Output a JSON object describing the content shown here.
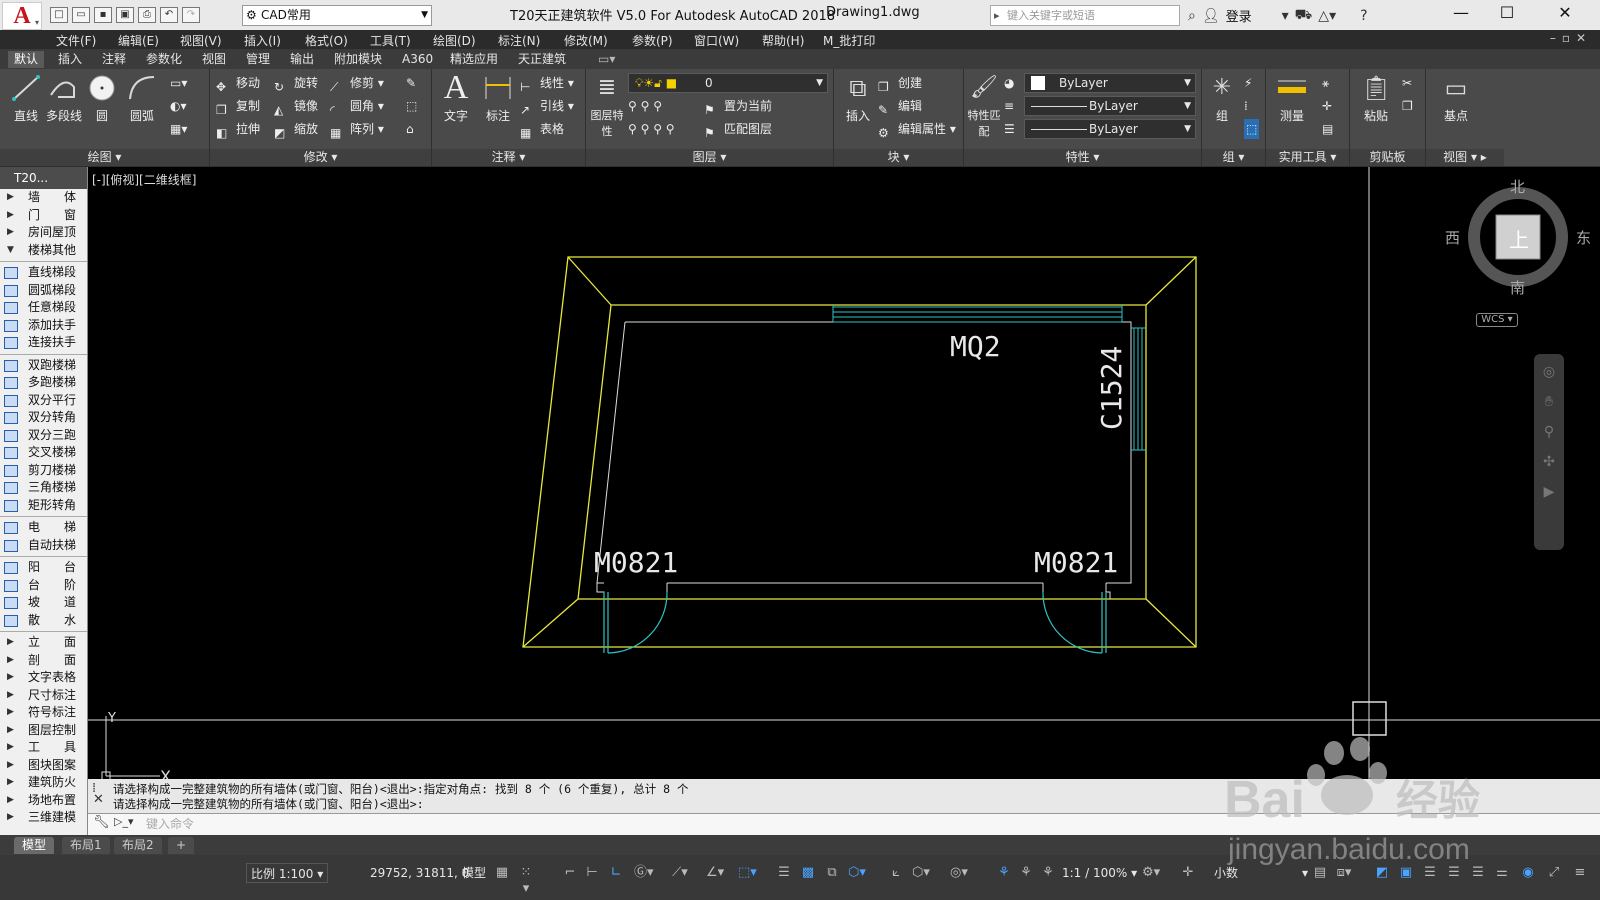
{
  "titlebar": {
    "app_version_badge": "T20",
    "workspace": "CAD常用",
    "title": "T20天正建筑软件 V5.0 For Autodesk AutoCAD 2018",
    "file": "Drawing1.dwg",
    "search_placeholder": "键入关键字或短语",
    "login": "登录"
  },
  "menu": [
    "文件(F)",
    "编辑(E)",
    "视图(V)",
    "插入(I)",
    "格式(O)",
    "工具(T)",
    "绘图(D)",
    "标注(N)",
    "修改(M)",
    "参数(P)",
    "窗口(W)",
    "帮助(H)",
    "M_批打印"
  ],
  "ribbon_tabs": [
    "默认",
    "插入",
    "注释",
    "参数化",
    "视图",
    "管理",
    "输出",
    "附加模块",
    "A360",
    "精选应用",
    "天正建筑"
  ],
  "ribbon": {
    "draw": {
      "title": "绘图",
      "line": "直线",
      "polyline": "多段线",
      "circle": "圆",
      "arc": "圆弧"
    },
    "modify": {
      "title": "修改",
      "move": "移动",
      "rotate": "旋转",
      "trim": "修剪",
      "copy": "复制",
      "mirror": "镜像",
      "fillet": "圆角",
      "stretch": "拉伸",
      "scale": "缩放",
      "array": "阵列"
    },
    "annotation": {
      "title": "注释",
      "text": "文字",
      "dimension": "标注",
      "linear": "线性",
      "leader": "引线",
      "table": "表格"
    },
    "layers": {
      "title": "图层",
      "props": "图层特性",
      "current_layer": "0",
      "set_current": "置为当前",
      "match_layer": "匹配图层"
    },
    "block": {
      "title": "块",
      "insert": "插入",
      "create": "创建",
      "edit": "编辑",
      "edit_attr": "编辑属性"
    },
    "properties": {
      "title": "特性",
      "match": "特性匹配",
      "color": "ByLayer",
      "linetype": "ByLayer",
      "lineweight": "ByLayer"
    },
    "groups": {
      "title": "组",
      "group": "组"
    },
    "utilities": {
      "title": "实用工具",
      "measure": "测量"
    },
    "clipboard": {
      "title": "剪贴板",
      "paste": "粘贴"
    },
    "view": {
      "title": "视图",
      "base": "基点"
    }
  },
  "palette": {
    "header": "T20...",
    "items": [
      {
        "label": "墙　　体",
        "type": "folder"
      },
      {
        "label": "门　　窗",
        "type": "folder"
      },
      {
        "label": "房间屋顶",
        "type": "folder"
      },
      {
        "label": "楼梯其他",
        "type": "open"
      },
      {
        "label": "直线梯段",
        "type": "tool"
      },
      {
        "label": "圆弧梯段",
        "type": "tool"
      },
      {
        "label": "任意梯段",
        "type": "tool"
      },
      {
        "label": "添加扶手",
        "type": "tool"
      },
      {
        "label": "连接扶手",
        "type": "tool"
      },
      {
        "label": "双跑楼梯",
        "type": "tool"
      },
      {
        "label": "多跑楼梯",
        "type": "tool"
      },
      {
        "label": "双分平行",
        "type": "tool"
      },
      {
        "label": "双分转角",
        "type": "tool"
      },
      {
        "label": "双分三跑",
        "type": "tool"
      },
      {
        "label": "交叉楼梯",
        "type": "tool"
      },
      {
        "label": "剪刀楼梯",
        "type": "tool"
      },
      {
        "label": "三角楼梯",
        "type": "tool"
      },
      {
        "label": "矩形转角",
        "type": "tool"
      },
      {
        "label": "电　　梯",
        "type": "tool"
      },
      {
        "label": "自动扶梯",
        "type": "tool"
      },
      {
        "label": "阳　　台",
        "type": "tool"
      },
      {
        "label": "台　　阶",
        "type": "tool"
      },
      {
        "label": "坡　　道",
        "type": "tool"
      },
      {
        "label": "散　　水",
        "type": "tool"
      },
      {
        "label": "立　　面",
        "type": "folder"
      },
      {
        "label": "剖　　面",
        "type": "folder"
      },
      {
        "label": "文字表格",
        "type": "folder"
      },
      {
        "label": "尺寸标注",
        "type": "folder"
      },
      {
        "label": "符号标注",
        "type": "folder"
      },
      {
        "label": "图层控制",
        "type": "folder"
      },
      {
        "label": "工　　具",
        "type": "folder"
      },
      {
        "label": "图块图案",
        "type": "folder"
      },
      {
        "label": "建筑防火",
        "type": "folder"
      },
      {
        "label": "场地布置",
        "type": "folder"
      },
      {
        "label": "三维建模",
        "type": "folder"
      }
    ]
  },
  "canvas": {
    "viewport_label": "[-][俯视][二维线框]",
    "tags": {
      "curtain_wall": "MQ2",
      "window": "C1524",
      "door_left": "M0821",
      "door_right": "M0821"
    },
    "ucs_x": "X",
    "ucs_y": "Y"
  },
  "viewcube": {
    "north": "北",
    "south": "南",
    "east": "东",
    "west": "西",
    "top": "上",
    "wcs": "WCS"
  },
  "command": {
    "history": [
      "请选择构成一完整建筑物的所有墙体(或门窗、阳台)<退出>:指定对角点: 找到 8 个 (6 个重复), 总计 8 个",
      "请选择构成一完整建筑物的所有墙体(或门窗、阳台)<退出>:"
    ],
    "placeholder": "键入命令"
  },
  "layout_tabs": [
    "模型",
    "布局1",
    "布局2",
    "+"
  ],
  "status": {
    "scale": "比例 1:100",
    "coords": "29752, 31811, 0",
    "model": "模型",
    "annoscale": "1:1 / 100%",
    "units": "小数"
  },
  "watermark": {
    "brand": "Bai",
    "brand_cn": "经验",
    "url": "jingyan.baidu.com"
  },
  "colors": {
    "wall": "#e8e83c",
    "door": "#2ec4c4",
    "accent": "#c4161c",
    "canvas": "#000000"
  }
}
